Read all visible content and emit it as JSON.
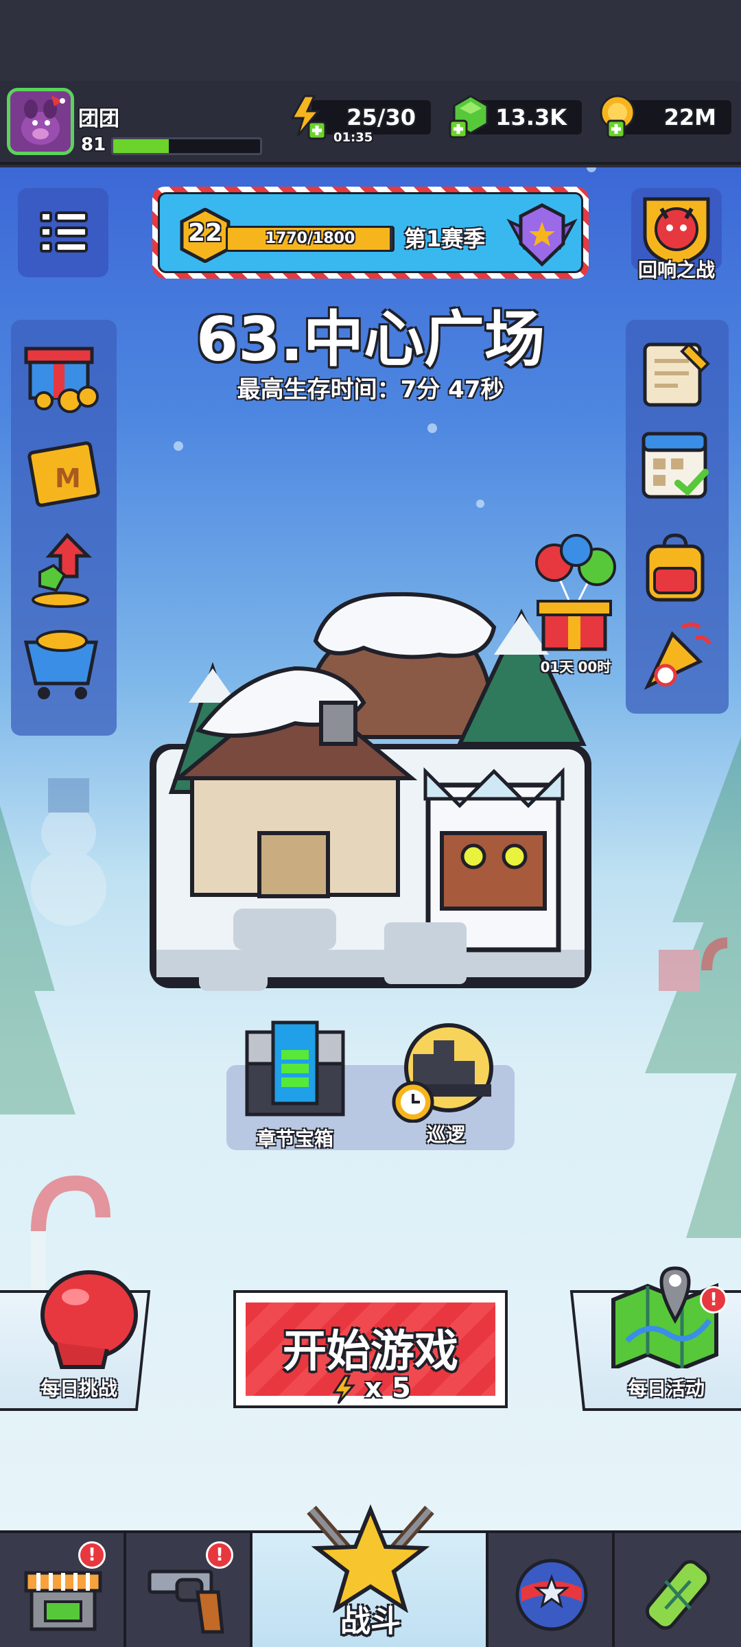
{
  "player": {
    "name": "团团",
    "level": "81",
    "xp_fraction": 0.38
  },
  "resources": {
    "energy": "25/30",
    "energy_timer": "01:35",
    "gems": "13.3K",
    "coins": "22M"
  },
  "season": {
    "level": "22",
    "progress": "1770/1800",
    "progress_fraction": 0.983,
    "title": "第1赛季"
  },
  "echo_battle_label": "回响之战",
  "stage": {
    "title": "63.中心广场",
    "best_time": "最高生存时间：7分 47秒"
  },
  "gift_timer": "01天 00时",
  "chapter_chest_label": "章节宝箱",
  "patrol_label": "巡逻",
  "start_button": {
    "label": "开始游戏",
    "cost": "x 5"
  },
  "daily_challenge_label": "每日挑战",
  "daily_events_label": "每日活动",
  "bottom_nav": {
    "battle_label": "战斗",
    "badge": "!"
  },
  "colors": {
    "accent_red": "#e9373f",
    "energy_yellow": "#f7b51d",
    "gem_green": "#6bd32b",
    "sky_blue": "#4d86e0"
  }
}
